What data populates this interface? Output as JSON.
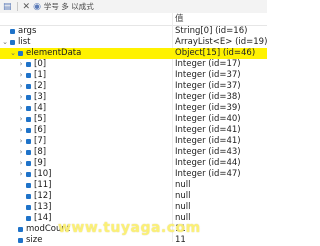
{
  "toolbar": {
    "text": "学号 多 以成式"
  },
  "header": {
    "name_label": "",
    "value_label": "值"
  },
  "rows": [
    {
      "name": "args",
      "value": "String[0] (id=16)"
    },
    {
      "name": "list",
      "value": "ArrayList<E> (id=19)"
    },
    {
      "name": "elementData",
      "value": "Object[15] (id=46)"
    },
    {
      "name": "[0]",
      "value": "Integer (id=17)"
    },
    {
      "name": "[1]",
      "value": "Integer (id=37)"
    },
    {
      "name": "[2]",
      "value": "Integer (id=37)"
    },
    {
      "name": "[3]",
      "value": "Integer (id=38)"
    },
    {
      "name": "[4]",
      "value": "Integer (id=39)"
    },
    {
      "name": "[5]",
      "value": "Integer (id=40)"
    },
    {
      "name": "[6]",
      "value": "Integer (id=41)"
    },
    {
      "name": "[7]",
      "value": "Integer (id=41)"
    },
    {
      "name": "[8]",
      "value": "Integer (id=43)"
    },
    {
      "name": "[9]",
      "value": "Integer (id=44)"
    },
    {
      "name": "[10]",
      "value": "Integer (id=47)"
    },
    {
      "name": "[11]",
      "value": "null"
    },
    {
      "name": "[12]",
      "value": "null"
    },
    {
      "name": "[13]",
      "value": "null"
    },
    {
      "name": "[14]",
      "value": "null"
    },
    {
      "name": "modCount",
      "value": "11"
    },
    {
      "name": "size",
      "value": "11"
    }
  ],
  "watermark": "www.tuyaga.com"
}
